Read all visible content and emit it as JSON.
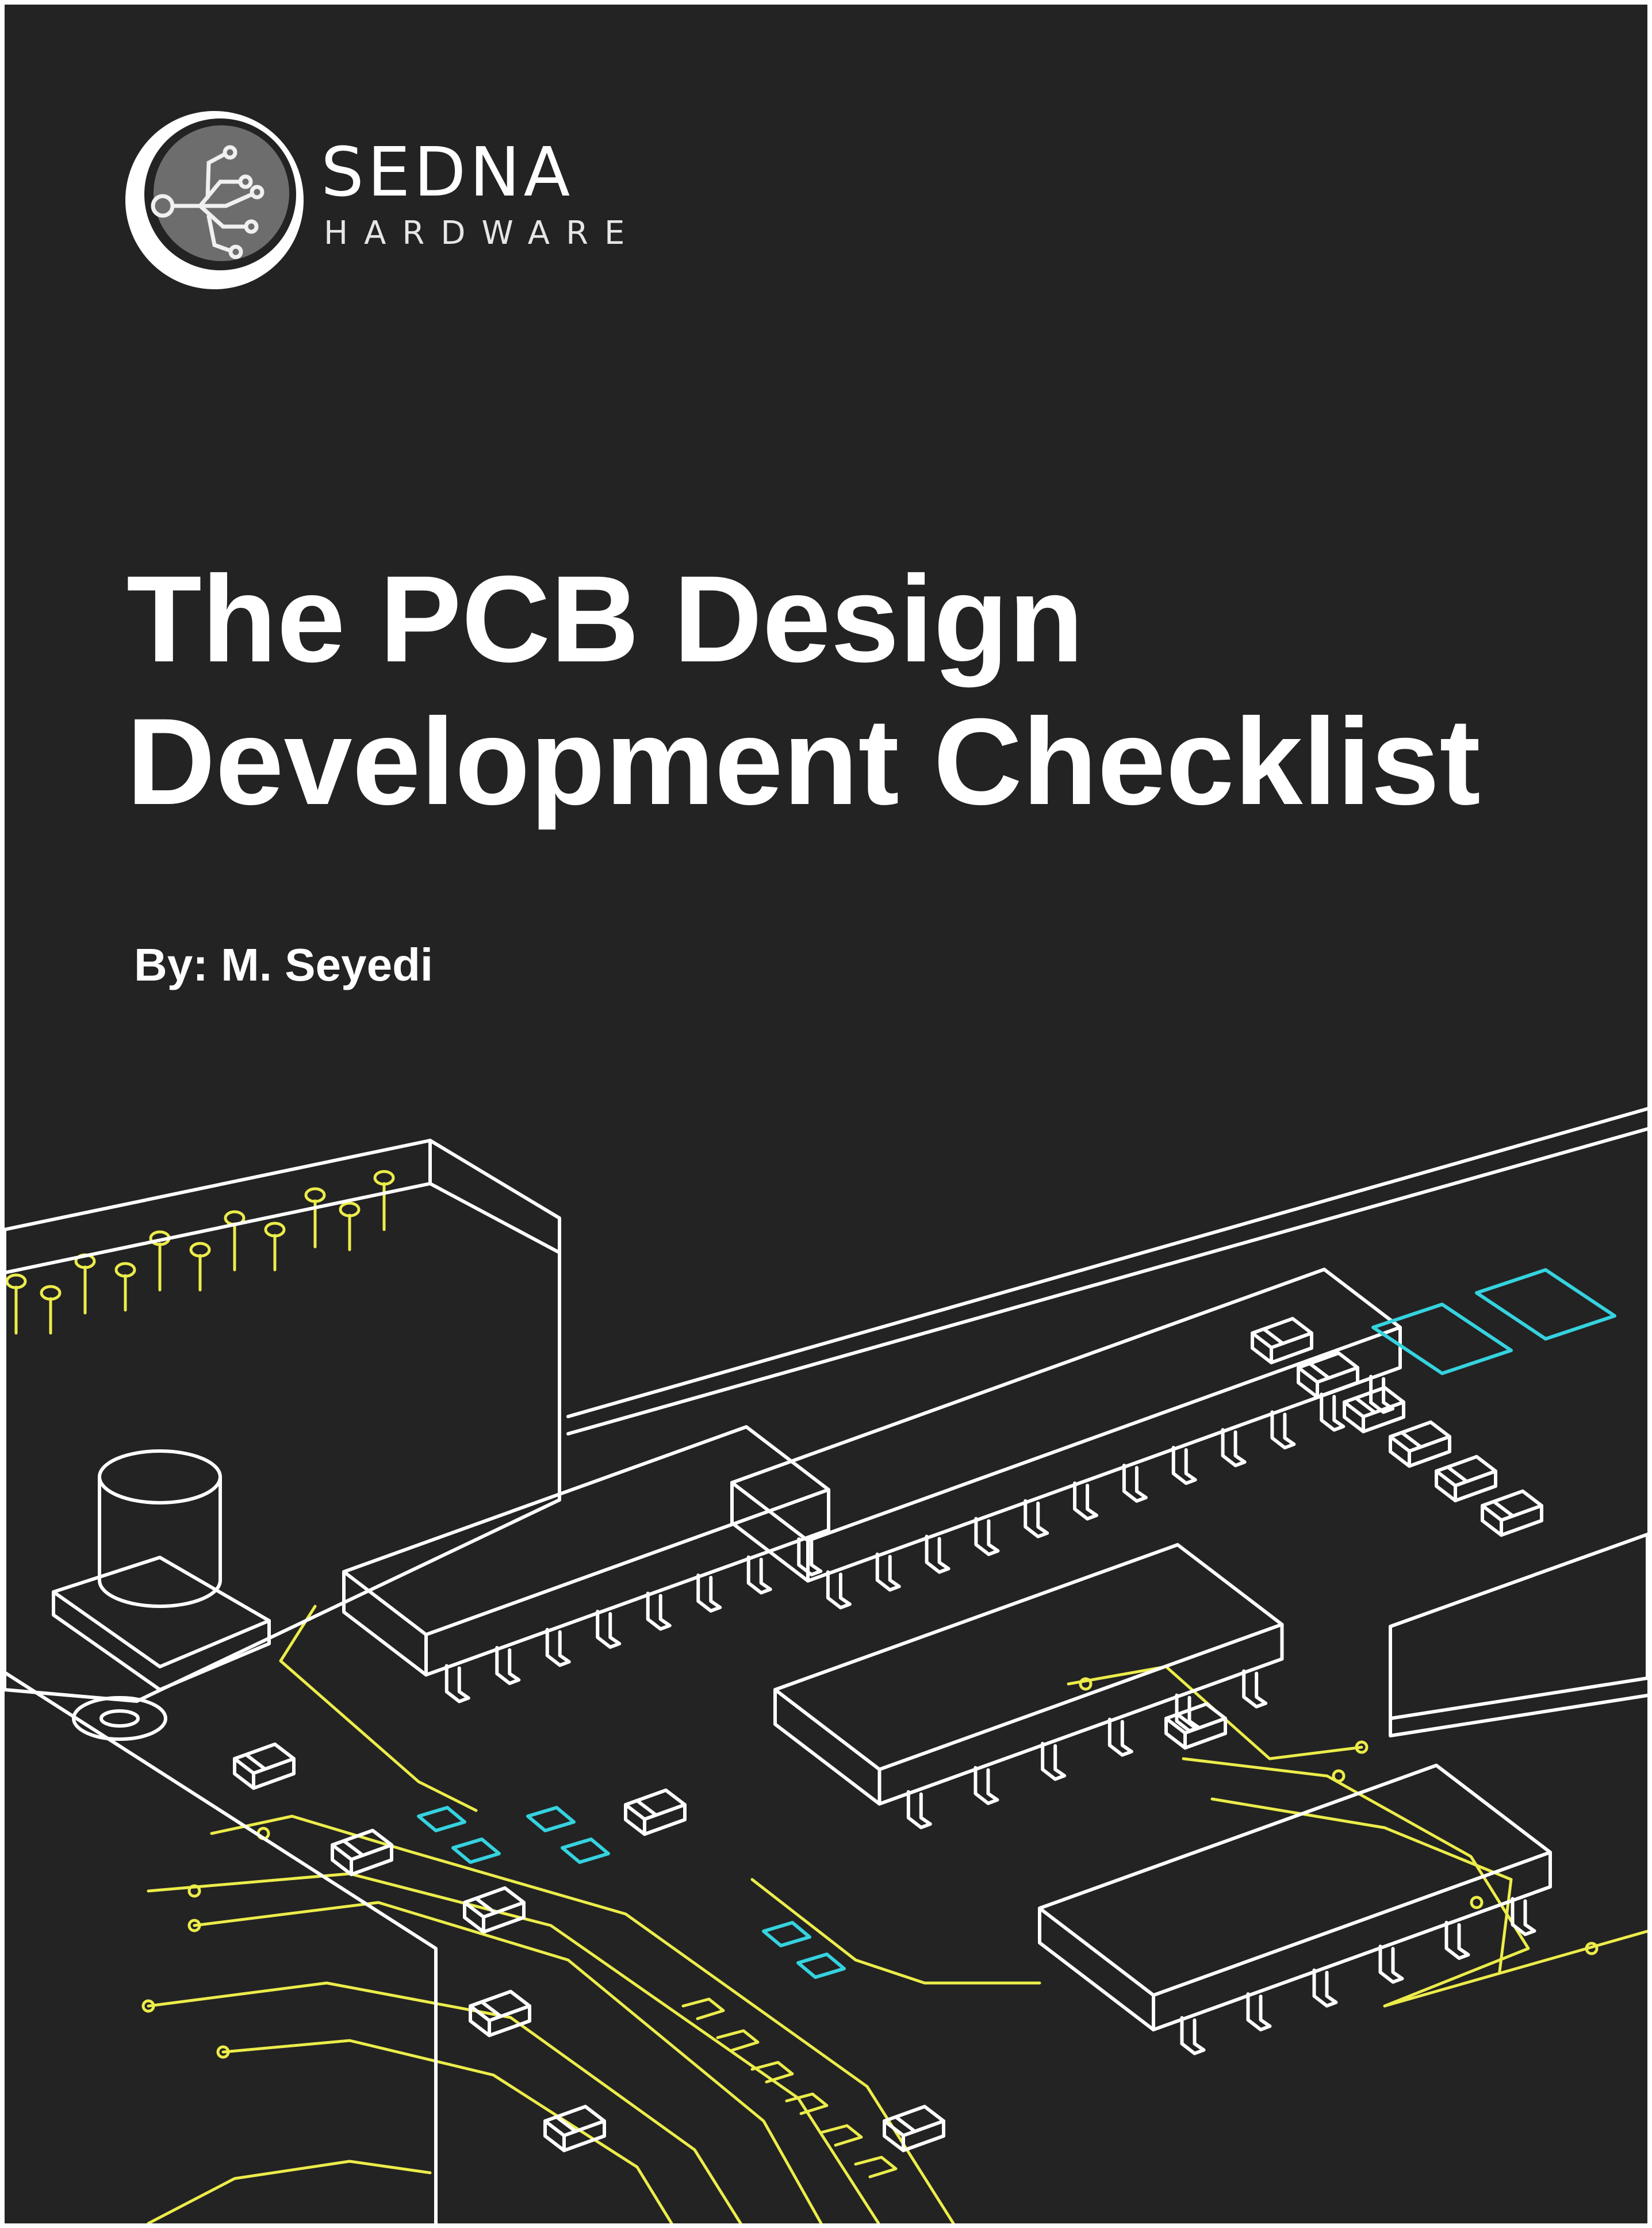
{
  "brand": {
    "name": "SEDNA",
    "subtitle": "HARDWARE",
    "logo_icon": "circuit-node-icon"
  },
  "cover": {
    "title_line1": "The PCB Design",
    "title_line2": "Development Checklist",
    "byline": "By: M. Seyedi",
    "illustration": "pcb-illustration"
  },
  "colors": {
    "background": "#242324",
    "text": "#ffffff",
    "outline": "#ffffff",
    "trace": "#ecec4a",
    "pad": "#34d3df"
  }
}
